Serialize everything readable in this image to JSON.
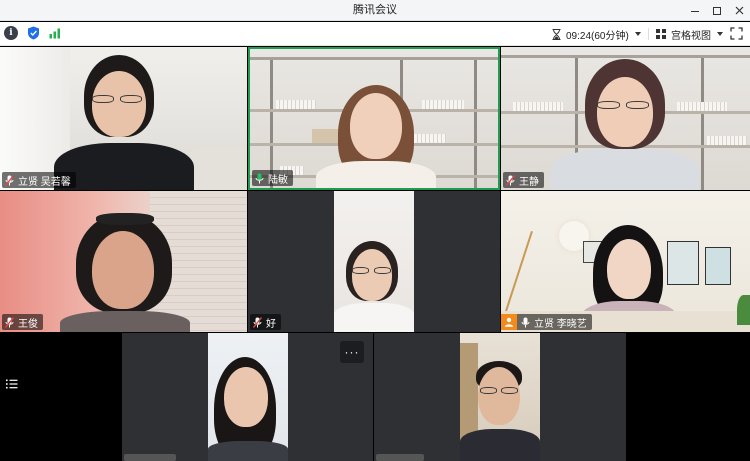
{
  "window": {
    "title": "腾讯会议"
  },
  "toolbar": {
    "timer_label": "09:24(60分钟)",
    "view_label": "宫格视图",
    "info_icon": "info-icon",
    "shield_icon": "shield-icon",
    "signal_icon": "signal-icon",
    "fullscreen_icon": "fullscreen-icon"
  },
  "participants": [
    {
      "name": "立贤 吴若馨",
      "mic": "muted"
    },
    {
      "name": "陆敏",
      "mic": "speaking",
      "active": true
    },
    {
      "name": "王静",
      "mic": "muted"
    },
    {
      "name": "王俊",
      "mic": "muted"
    },
    {
      "name": "好",
      "mic": "muted"
    },
    {
      "name": "立贤 李晓艺",
      "mic": "on",
      "avatar_badge": true
    },
    {
      "name": "",
      "mic": "muted"
    },
    {
      "name": "",
      "mic": "muted"
    }
  ],
  "controls": {
    "more_label": "···",
    "side_panel_icon": "list-icon"
  },
  "colors": {
    "active_speaker_border": "#1f9b53",
    "muted_red": "#e54545",
    "speaking_green": "#23c35b",
    "badge_orange": "#f38a1c",
    "shield_blue": "#1e6fe8",
    "signal_green": "#23b14d"
  }
}
